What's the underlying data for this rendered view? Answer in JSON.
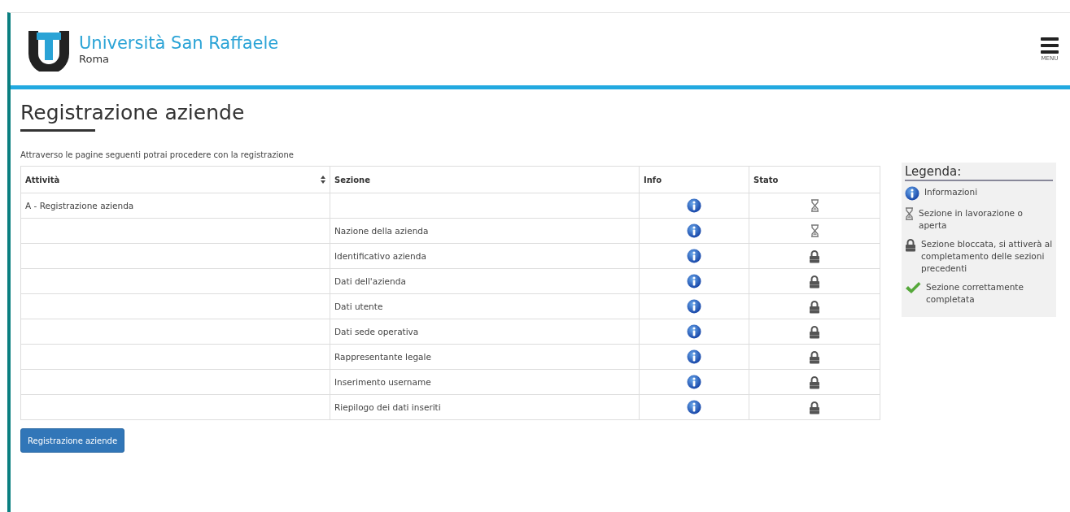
{
  "header": {
    "brand": "Università San Raffaele",
    "city": "Roma",
    "menu_label": "MENU"
  },
  "page": {
    "title": "Registrazione aziende",
    "intro": "Attraverso le pagine seguenti potrai procedere con la registrazione"
  },
  "table": {
    "columns": [
      "Attività",
      "Sezione",
      "Info",
      "Stato"
    ],
    "rows": [
      {
        "attivita": "A - Registrazione azienda",
        "sezione": "",
        "kind": "in_progress"
      },
      {
        "attivita": "",
        "sezione": "Nazione della azienda",
        "kind": "in_progress"
      },
      {
        "attivita": "",
        "sezione": "Identificativo azienda",
        "kind": "locked"
      },
      {
        "attivita": "",
        "sezione": "Dati dell'azienda",
        "kind": "locked"
      },
      {
        "attivita": "",
        "sezione": "Dati utente",
        "kind": "locked"
      },
      {
        "attivita": "",
        "sezione": "Dati sede operativa",
        "kind": "locked"
      },
      {
        "attivita": "",
        "sezione": "Rappresentante legale",
        "kind": "locked"
      },
      {
        "attivita": "",
        "sezione": "Inserimento username",
        "kind": "locked"
      },
      {
        "attivita": "",
        "sezione": "Riepilogo dei dati inseriti",
        "kind": "locked"
      }
    ]
  },
  "button": "Registrazione aziende",
  "legend": {
    "title": "Legenda:",
    "items": [
      {
        "kind": "info",
        "text": "Informazioni"
      },
      {
        "kind": "in_progress",
        "text": "Sezione in lavorazione o aperta"
      },
      {
        "kind": "locked",
        "text": "Sezione bloccata, si attiverà al completamento delle sezioni precedenti"
      },
      {
        "kind": "done",
        "text": "Sezione correttamente completata"
      }
    ]
  }
}
